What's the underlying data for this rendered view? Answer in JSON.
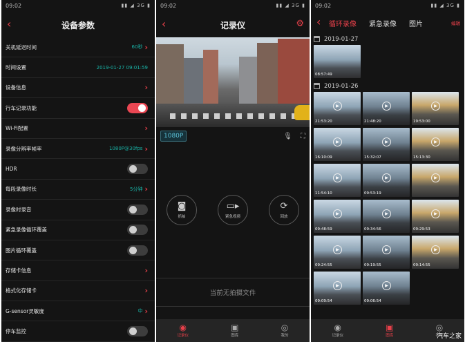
{
  "status": {
    "time": "09:02",
    "indicators": "▮▮ ◢ 3G ▮"
  },
  "settings": {
    "title": "设备参数",
    "rows": [
      {
        "label": "关机延迟时间",
        "value": "60秒",
        "kind": "value-arrow"
      },
      {
        "label": "时间设置",
        "value": "2019-01-27 09:01:59",
        "kind": "value"
      },
      {
        "label": "设备信息",
        "kind": "arrow"
      },
      {
        "label": "行车记录功能",
        "kind": "toggle",
        "on": true
      },
      {
        "label": "Wi-Fi配置",
        "kind": "arrow"
      },
      {
        "label": "录像分辨率帧率",
        "value": "1080P@30fps",
        "kind": "value-arrow"
      },
      {
        "label": "HDR",
        "kind": "toggle",
        "on": false
      },
      {
        "label": "每段录像时长",
        "value": "5分钟",
        "kind": "value-arrow"
      },
      {
        "label": "录像时录音",
        "kind": "toggle",
        "on": false
      },
      {
        "label": "紧急录像循环覆盖",
        "kind": "toggle",
        "on": false
      },
      {
        "label": "图片循环覆盖",
        "kind": "toggle",
        "on": false
      },
      {
        "label": "存储卡信息",
        "kind": "arrow"
      },
      {
        "label": "格式化存储卡",
        "kind": "arrow"
      },
      {
        "label": "G-sensor灵敏度",
        "value": "中",
        "kind": "value-arrow"
      },
      {
        "label": "停车监控",
        "kind": "toggle",
        "on": false
      }
    ]
  },
  "recorder": {
    "title": "记录仪",
    "resolution": "1080P",
    "actions": {
      "photo": "抓拍",
      "emergency": "紧急视频",
      "playback": "回放"
    },
    "empty_text": "当前无拍摄文件"
  },
  "nav": {
    "recorder": "记录仪",
    "gallery": "图库",
    "mine": "我的"
  },
  "gallery": {
    "tabs": {
      "loop": "循环录像",
      "emergency": "紧急录像",
      "photos": "图片"
    },
    "edit": "编辑",
    "date1": "2019-01-27",
    "date2": "2019-01-26",
    "day1": [
      "08:57:49"
    ],
    "day2": [
      "21:53:20",
      "21:48:20",
      "19:53:00",
      "16:10:09",
      "15:32:07",
      "15:13:30",
      "11:54:10",
      "09:53:19",
      "",
      "09:48:59",
      "09:34:56",
      "09:29:53",
      "09:24:55",
      "09:19:55",
      "09:14:55",
      "09:09:54",
      "09:06:54"
    ]
  },
  "watermark": "汽车之家",
  "colors": {
    "accent": "#e8404a",
    "teal": "#19b4a8",
    "background": "#141414"
  }
}
